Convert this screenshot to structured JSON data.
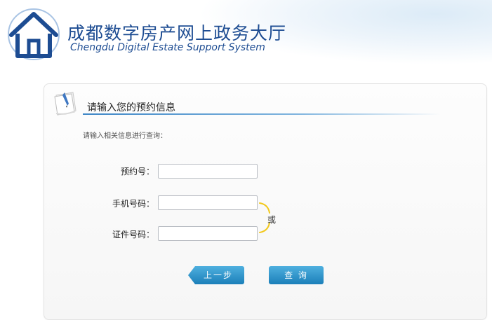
{
  "header": {
    "title_cn": "成都数字房产网上政务大厅",
    "title_en": "Chengdu Digital Estate Support System"
  },
  "form": {
    "section_title": "请输入您的预约信息",
    "hint": "请输入相关信息进行查询：",
    "fields": [
      {
        "label": "预约号：",
        "value": ""
      },
      {
        "label": "手机号码：",
        "value": ""
      },
      {
        "label": "证件号码：",
        "value": ""
      }
    ],
    "or_label": "或"
  },
  "buttons": {
    "prev": "上一步",
    "query": "查 询"
  },
  "colors": {
    "brand_blue": "#1d4c92",
    "button_blue": "#1b7fb9",
    "bracket_yellow": "#f2c81b"
  },
  "icons": {
    "logo": "house-logo-icon",
    "section": "notebook-pen-icon"
  }
}
